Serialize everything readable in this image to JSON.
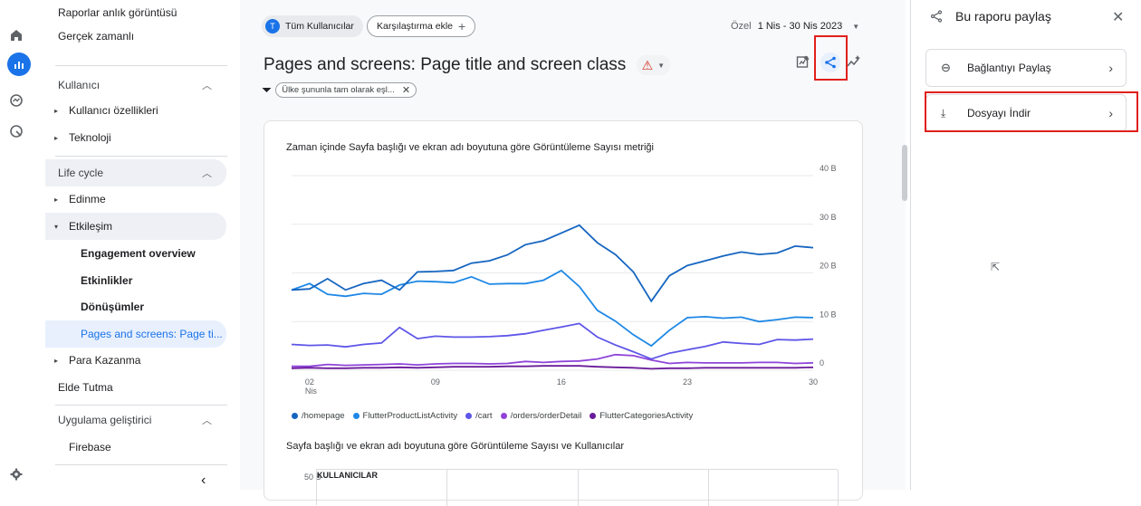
{
  "nav": {
    "snapshot": "Raporlar anlık görüntüsü",
    "realtime": "Gerçek zamanlı",
    "user_section": "Kullanıcı",
    "user_props": "Kullanıcı özellikleri",
    "tech": "Teknoloji",
    "lifecycle": "Life cycle",
    "acquisition": "Edinme",
    "engagement": "Etkileşim",
    "eng_overview": "Engagement overview",
    "events": "Etkinlikler",
    "conversions": "Dönüşümler",
    "pages": "Pages and screens: Page ti...",
    "monetization": "Para Kazanma",
    "retention": "Elde Tutma",
    "app_dev": "Uygulama geliştirici",
    "firebase": "Firebase"
  },
  "header": {
    "segment_initial": "T",
    "segment": "Tüm Kullanıcılar",
    "compare": "Karşılaştırma ekle",
    "date_prefix": "Özel",
    "date_range": "1 Nis - 30 Nis 2023",
    "title": "Pages and screens: Page title and screen class",
    "filter": "Ülke şununla tam olarak eşl..."
  },
  "card": {
    "chart_title": "Zaman içinde Sayfa başlığı ve ekran adı boyutuna göre Görüntüleme Sayısı metriği",
    "table_title": "Sayfa başlığı ve ekran adı boyutuna göre Görüntüleme Sayısı ve Kullanıcılar",
    "table_tick": "50 B",
    "table_header": "KULLANICILAR"
  },
  "panel": {
    "title": "Bu raporu paylaş",
    "share_link": "Bağlantıyı Paylaş",
    "download": "Dosyayı İndir"
  },
  "colors": {
    "accent": "#1a73e8",
    "highlight": "#e0201c"
  },
  "chart_data": {
    "type": "line",
    "x": [
      1,
      2,
      3,
      4,
      5,
      6,
      7,
      8,
      9,
      10,
      11,
      12,
      13,
      14,
      15,
      16,
      17,
      18,
      19,
      20,
      21,
      22,
      23,
      24,
      25,
      26,
      27,
      28,
      29,
      30
    ],
    "x_ticks": [
      {
        "x": 2,
        "label": "02",
        "sub": "Nis"
      },
      {
        "x": 9,
        "label": "09",
        "sub": ""
      },
      {
        "x": 16,
        "label": "16",
        "sub": ""
      },
      {
        "x": 23,
        "label": "23",
        "sub": ""
      },
      {
        "x": 30,
        "label": "30",
        "sub": ""
      }
    ],
    "y_ticks": [
      {
        "v": 0,
        "label": "0"
      },
      {
        "v": 10,
        "label": "10 B"
      },
      {
        "v": 20,
        "label": "20 B"
      },
      {
        "v": 30,
        "label": "30 B"
      },
      {
        "v": 40,
        "label": "40 B"
      }
    ],
    "ylim": [
      0,
      40
    ],
    "grid": true,
    "legend_position": "bottom",
    "series": [
      {
        "name": "/homepage",
        "color": "#1565c0",
        "values": [
          16.5,
          16.7,
          18.8,
          16.5,
          17.8,
          18.5,
          16.5,
          20.2,
          20.3,
          20.5,
          22,
          22.5,
          23.7,
          25.8,
          26.6,
          28.2,
          29.8,
          26.2,
          23.8,
          20.2,
          14.2,
          19.4,
          21.5,
          22.5,
          23.5,
          24.3,
          23.8,
          24.1,
          25.5,
          25.2
        ]
      },
      {
        "name": "FlutterProductListActivity",
        "color": "#1e88e5",
        "values": [
          16.5,
          17.8,
          15.6,
          15.2,
          15.8,
          15.6,
          17.5,
          18.3,
          18.2,
          18,
          19.2,
          17.7,
          17.8,
          17.8,
          18.5,
          20.5,
          17.2,
          12.3,
          10.1,
          7.3,
          5,
          8.2,
          10.8,
          11,
          10.7,
          10.9,
          10,
          10.4,
          10.9,
          10.8
        ]
      },
      {
        "name": "/cart",
        "color": "#5e56e8",
        "values": [
          5.3,
          5.1,
          5.2,
          4.8,
          5.3,
          5.6,
          8.8,
          6.5,
          7,
          6.8,
          6.8,
          6.9,
          7.1,
          7.5,
          8.2,
          8.9,
          9.6,
          6.8,
          5.2,
          3.8,
          2.3,
          3.5,
          4.2,
          4.9,
          5.8,
          5.5,
          5.3,
          6.3,
          6.2,
          6.4
        ]
      },
      {
        "name": "/orders/orderDetail",
        "color": "#8e44d9",
        "values": [
          0.8,
          0.8,
          1.2,
          1,
          1.1,
          1.2,
          1.3,
          1.1,
          1.3,
          1.4,
          1.4,
          1.3,
          1.4,
          1.8,
          1.6,
          1.8,
          1.9,
          2.3,
          3.2,
          3,
          2.1,
          1.4,
          1.6,
          1.5,
          1.5,
          1.5,
          1.6,
          1.6,
          1.4,
          1.5
        ]
      },
      {
        "name": "FlutterCategoriesActivity",
        "color": "#6a1b9a",
        "values": [
          0.4,
          0.5,
          0.4,
          0.4,
          0.5,
          0.5,
          0.6,
          0.5,
          0.6,
          0.7,
          0.7,
          0.7,
          0.8,
          0.8,
          0.9,
          0.9,
          0.9,
          0.7,
          0.6,
          0.5,
          0.3,
          0.4,
          0.4,
          0.5,
          0.5,
          0.5,
          0.5,
          0.5,
          0.5,
          0.6
        ]
      }
    ]
  }
}
